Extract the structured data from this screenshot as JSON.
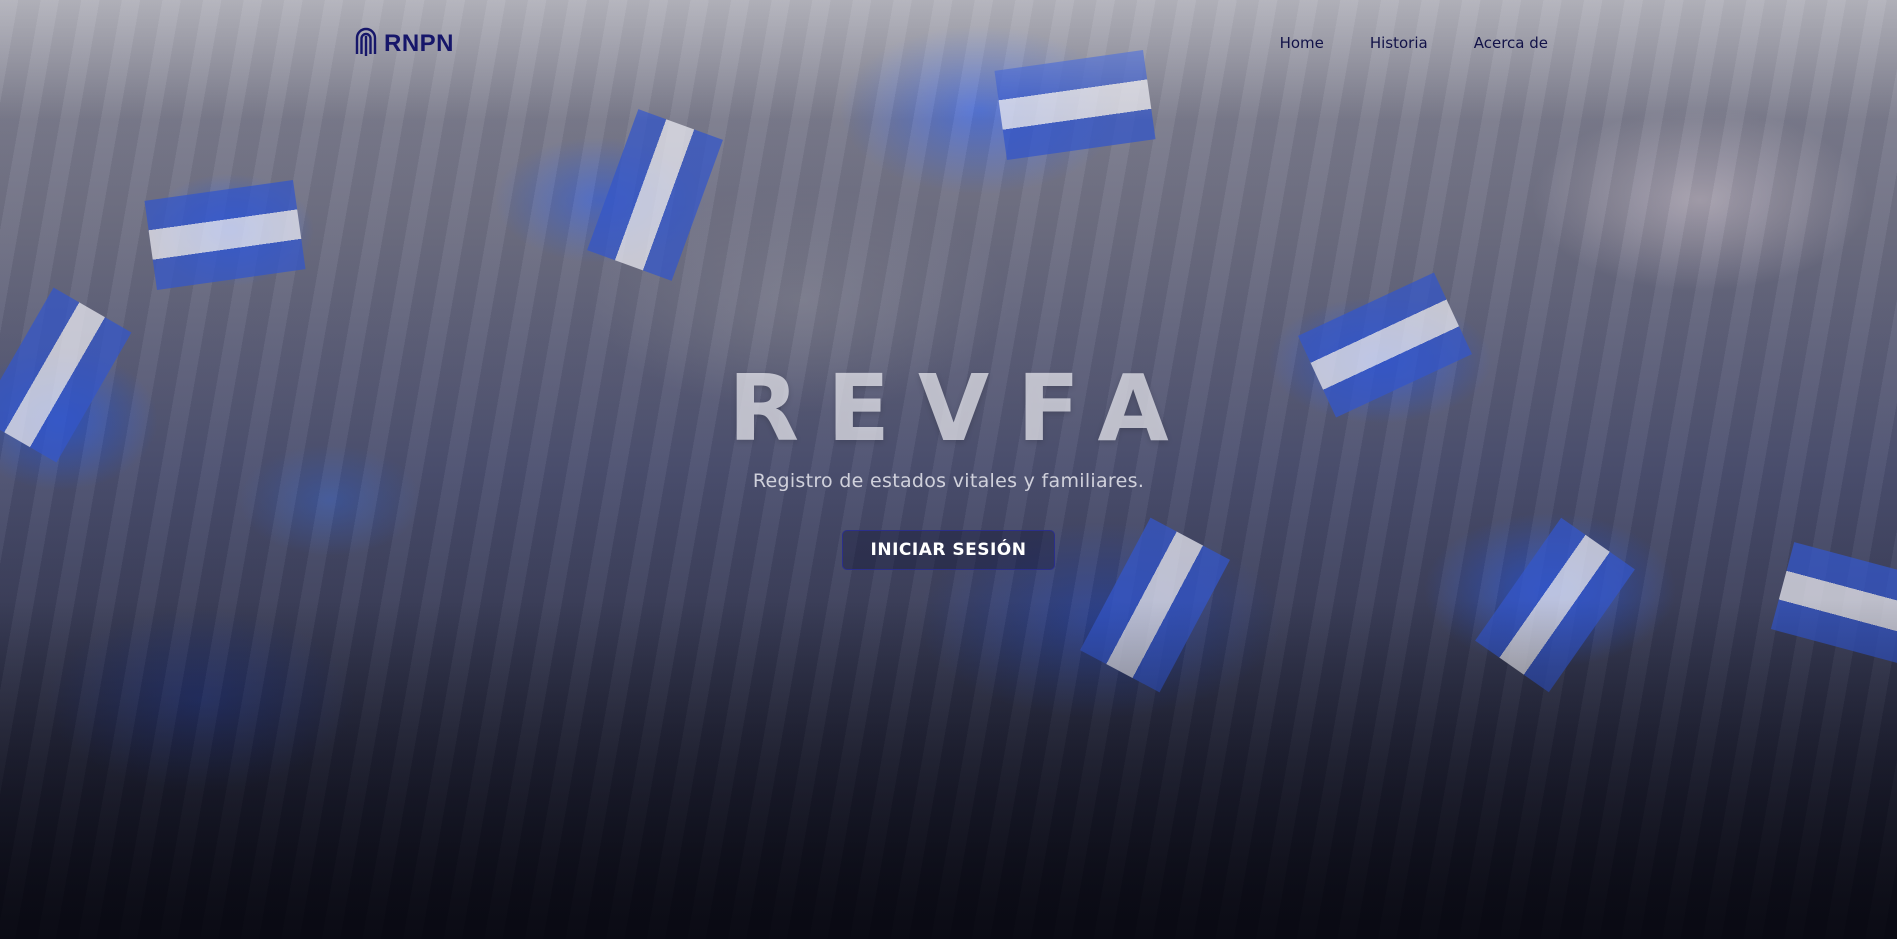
{
  "brand": {
    "name": "RNPN",
    "icon": "fingerprint-logo-icon",
    "color": "#16166a"
  },
  "nav": {
    "items": [
      {
        "label": "Home"
      },
      {
        "label": "Historia"
      },
      {
        "label": "Acerca de"
      }
    ]
  },
  "hero": {
    "title": "REVFA",
    "subtitle": "Registro de estados vitales y familiares.",
    "cta_label": "INICIAR SESIÓN",
    "background": "crowd-with-flags-photo"
  },
  "colors": {
    "accent": "#2b2f8a",
    "nav_text": "#121248",
    "flag_blue": "#3456c8"
  }
}
